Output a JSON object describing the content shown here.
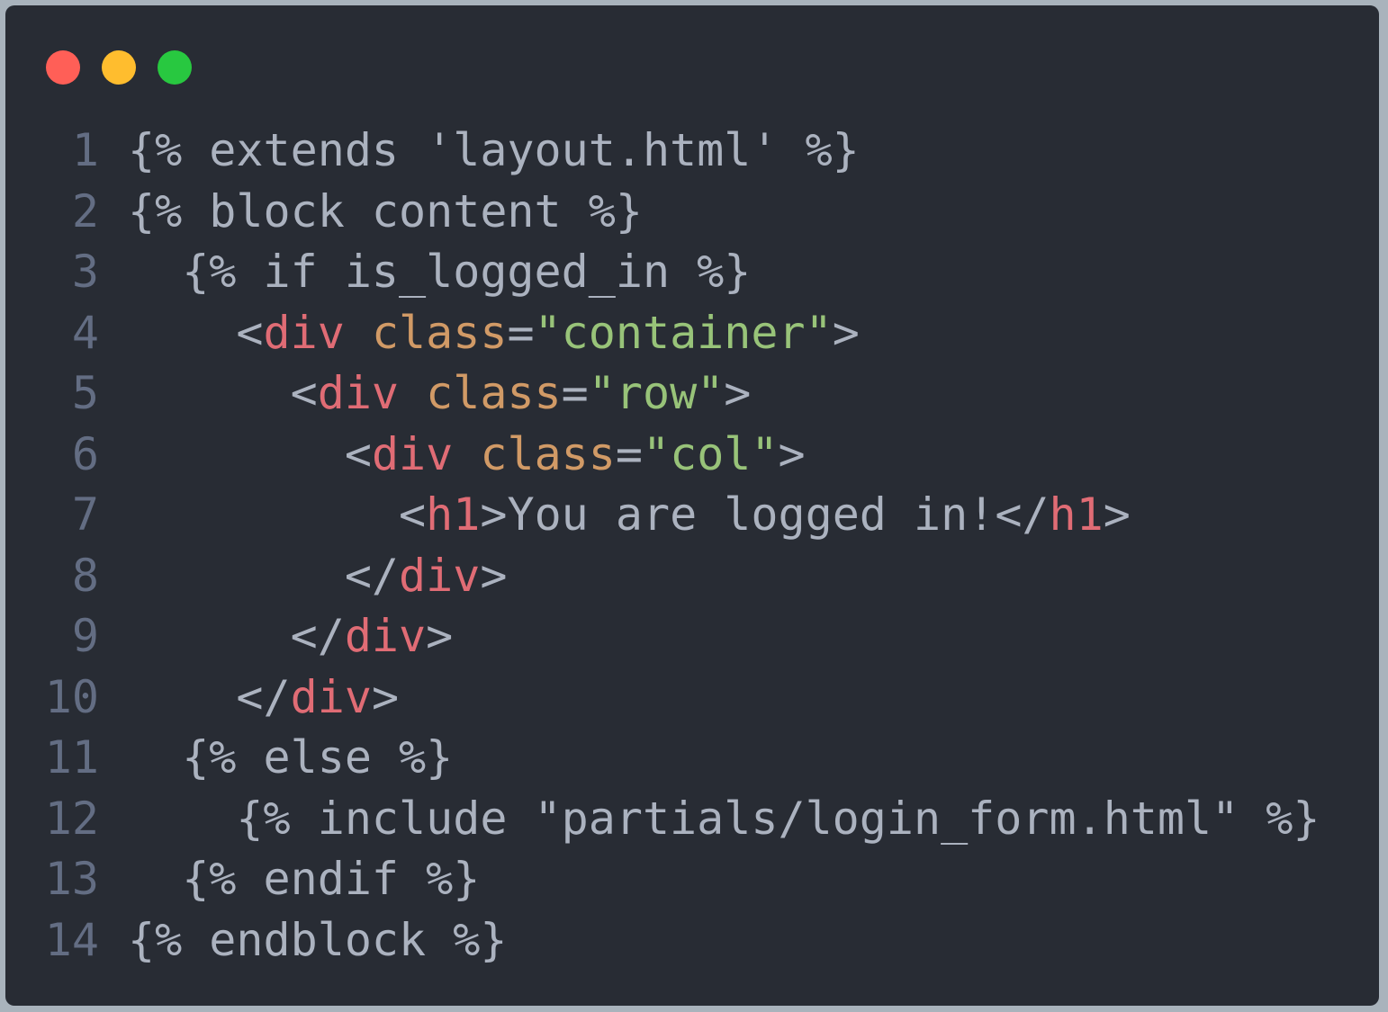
{
  "window": {
    "traffic_lights": [
      {
        "name": "close",
        "color": "#ff5f57"
      },
      {
        "name": "minimize",
        "color": "#ffbd2e"
      },
      {
        "name": "maximize",
        "color": "#28c840"
      }
    ]
  },
  "colors": {
    "background": "#282c34",
    "line_number": "#636d83",
    "text": "#abb2bf",
    "tag": "#e06c75",
    "attribute": "#d19a66",
    "string": "#98c379"
  },
  "code": {
    "lines": [
      {
        "number": "1",
        "tokens": [
          {
            "type": "text",
            "text": "{% extends 'layout.html' %}"
          }
        ]
      },
      {
        "number": "2",
        "tokens": [
          {
            "type": "text",
            "text": "{% block content %}"
          }
        ]
      },
      {
        "number": "3",
        "tokens": [
          {
            "type": "text",
            "text": "  {% if is_logged_in %}"
          }
        ]
      },
      {
        "number": "4",
        "tokens": [
          {
            "type": "punct",
            "text": "    <"
          },
          {
            "type": "tag",
            "text": "div"
          },
          {
            "type": "punct",
            "text": " "
          },
          {
            "type": "attr",
            "text": "class"
          },
          {
            "type": "punct",
            "text": "="
          },
          {
            "type": "str",
            "text": "\"container\""
          },
          {
            "type": "punct",
            "text": ">"
          }
        ]
      },
      {
        "number": "5",
        "tokens": [
          {
            "type": "punct",
            "text": "      <"
          },
          {
            "type": "tag",
            "text": "div"
          },
          {
            "type": "punct",
            "text": " "
          },
          {
            "type": "attr",
            "text": "class"
          },
          {
            "type": "punct",
            "text": "="
          },
          {
            "type": "str",
            "text": "\"row\""
          },
          {
            "type": "punct",
            "text": ">"
          }
        ]
      },
      {
        "number": "6",
        "tokens": [
          {
            "type": "punct",
            "text": "        <"
          },
          {
            "type": "tag",
            "text": "div"
          },
          {
            "type": "punct",
            "text": " "
          },
          {
            "type": "attr",
            "text": "class"
          },
          {
            "type": "punct",
            "text": "="
          },
          {
            "type": "str",
            "text": "\"col\""
          },
          {
            "type": "punct",
            "text": ">"
          }
        ]
      },
      {
        "number": "7",
        "tokens": [
          {
            "type": "punct",
            "text": "          <"
          },
          {
            "type": "tag",
            "text": "h1"
          },
          {
            "type": "punct",
            "text": ">"
          },
          {
            "type": "text",
            "text": "You are logged in!"
          },
          {
            "type": "punct",
            "text": "</"
          },
          {
            "type": "tag",
            "text": "h1"
          },
          {
            "type": "punct",
            "text": ">"
          }
        ]
      },
      {
        "number": "8",
        "tokens": [
          {
            "type": "punct",
            "text": "        </"
          },
          {
            "type": "tag",
            "text": "div"
          },
          {
            "type": "punct",
            "text": ">"
          }
        ]
      },
      {
        "number": "9",
        "tokens": [
          {
            "type": "punct",
            "text": "      </"
          },
          {
            "type": "tag",
            "text": "div"
          },
          {
            "type": "punct",
            "text": ">"
          }
        ]
      },
      {
        "number": "10",
        "tokens": [
          {
            "type": "punct",
            "text": "    </"
          },
          {
            "type": "tag",
            "text": "div"
          },
          {
            "type": "punct",
            "text": ">"
          }
        ]
      },
      {
        "number": "11",
        "tokens": [
          {
            "type": "text",
            "text": "  {% else %}"
          }
        ]
      },
      {
        "number": "12",
        "tokens": [
          {
            "type": "text",
            "text": "    {% include \"partials/login_form.html\" %}"
          }
        ]
      },
      {
        "number": "13",
        "tokens": [
          {
            "type": "text",
            "text": "  {% endif %}"
          }
        ]
      },
      {
        "number": "14",
        "tokens": [
          {
            "type": "text",
            "text": "{% endblock %}"
          }
        ]
      }
    ]
  }
}
